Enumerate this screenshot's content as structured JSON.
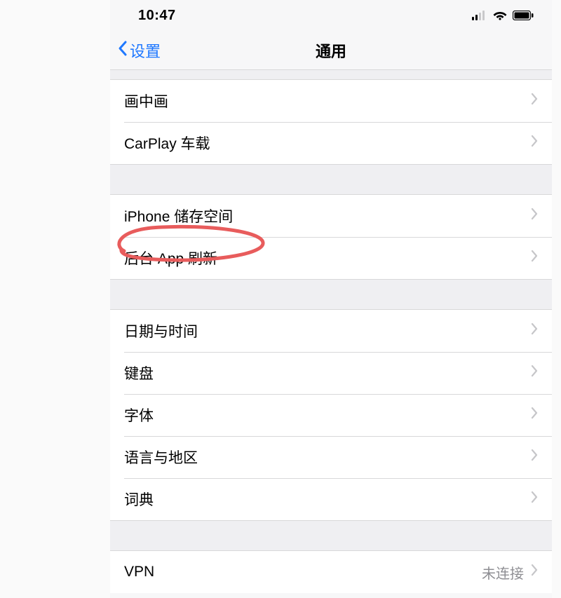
{
  "status": {
    "time": "10:47"
  },
  "nav": {
    "back_label": "设置",
    "title": "通用"
  },
  "group1": {
    "items": [
      {
        "label": "画中画"
      },
      {
        "label": "CarPlay 车载"
      }
    ]
  },
  "group2": {
    "items": [
      {
        "label": "iPhone 储存空间"
      },
      {
        "label": "后台 App 刷新"
      }
    ]
  },
  "group3": {
    "items": [
      {
        "label": "日期与时间"
      },
      {
        "label": "键盘"
      },
      {
        "label": "字体"
      },
      {
        "label": "语言与地区"
      },
      {
        "label": "词典"
      }
    ]
  },
  "group4": {
    "items": [
      {
        "label": "VPN",
        "detail": "未连接"
      }
    ]
  },
  "annotation": {
    "target": "后台 App 刷新",
    "color": "#e85c5c"
  }
}
